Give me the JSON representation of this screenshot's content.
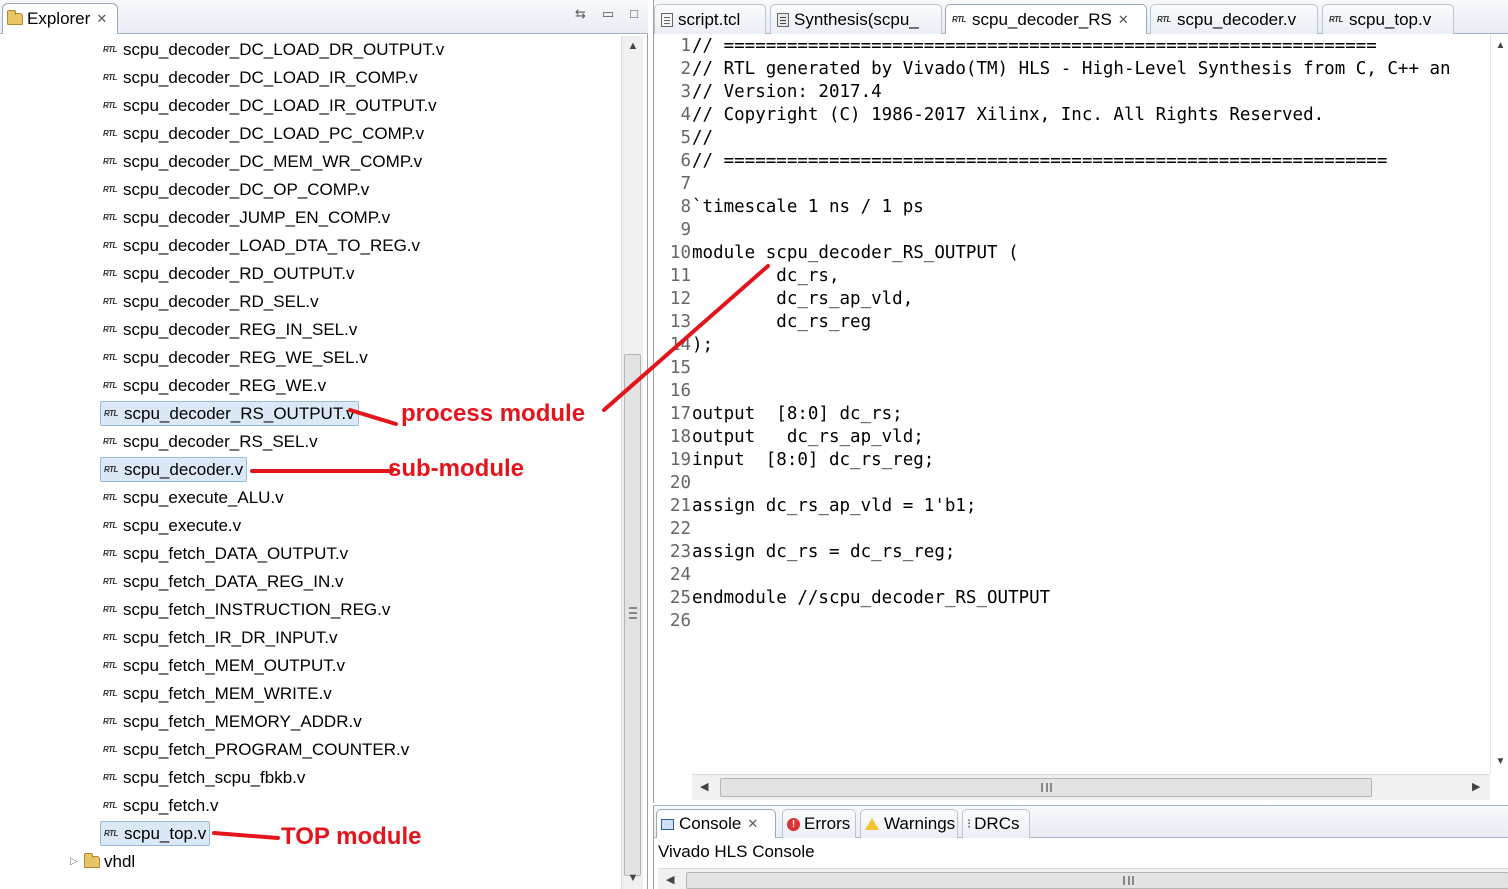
{
  "explorer": {
    "tab_label": "Explorer",
    "tree_items": [
      {
        "label": "scpu_decoder_DC_LOAD_DR_OUTPUT.v",
        "selected": false
      },
      {
        "label": "scpu_decoder_DC_LOAD_IR_COMP.v",
        "selected": false
      },
      {
        "label": "scpu_decoder_DC_LOAD_IR_OUTPUT.v",
        "selected": false
      },
      {
        "label": "scpu_decoder_DC_LOAD_PC_COMP.v",
        "selected": false
      },
      {
        "label": "scpu_decoder_DC_MEM_WR_COMP.v",
        "selected": false
      },
      {
        "label": "scpu_decoder_DC_OP_COMP.v",
        "selected": false
      },
      {
        "label": "scpu_decoder_JUMP_EN_COMP.v",
        "selected": false
      },
      {
        "label": "scpu_decoder_LOAD_DTA_TO_REG.v",
        "selected": false
      },
      {
        "label": "scpu_decoder_RD_OUTPUT.v",
        "selected": false
      },
      {
        "label": "scpu_decoder_RD_SEL.v",
        "selected": false
      },
      {
        "label": "scpu_decoder_REG_IN_SEL.v",
        "selected": false
      },
      {
        "label": "scpu_decoder_REG_WE_SEL.v",
        "selected": false
      },
      {
        "label": "scpu_decoder_REG_WE.v",
        "selected": false
      },
      {
        "label": "scpu_decoder_RS_OUTPUT.v",
        "selected": true
      },
      {
        "label": "scpu_decoder_RS_SEL.v",
        "selected": false
      },
      {
        "label": "scpu_decoder.v",
        "selected": true
      },
      {
        "label": "scpu_execute_ALU.v",
        "selected": false
      },
      {
        "label": "scpu_execute.v",
        "selected": false
      },
      {
        "label": "scpu_fetch_DATA_OUTPUT.v",
        "selected": false
      },
      {
        "label": "scpu_fetch_DATA_REG_IN.v",
        "selected": false
      },
      {
        "label": "scpu_fetch_INSTRUCTION_REG.v",
        "selected": false
      },
      {
        "label": "scpu_fetch_IR_DR_INPUT.v",
        "selected": false
      },
      {
        "label": "scpu_fetch_MEM_OUTPUT.v",
        "selected": false
      },
      {
        "label": "scpu_fetch_MEM_WRITE.v",
        "selected": false
      },
      {
        "label": "scpu_fetch_MEMORY_ADDR.v",
        "selected": false
      },
      {
        "label": "scpu_fetch_PROGRAM_COUNTER.v",
        "selected": false
      },
      {
        "label": "scpu_fetch_scpu_fbkb.v",
        "selected": false
      },
      {
        "label": "scpu_fetch.v",
        "selected": false
      },
      {
        "label": "scpu_top.v",
        "selected": true
      }
    ],
    "folder_label": "vhdl"
  },
  "editor": {
    "tabs": [
      {
        "label": "script.tcl",
        "icon": "tcl-file-icon",
        "active": false
      },
      {
        "label": "Synthesis(scpu_",
        "icon": "synthesis-report-icon",
        "active": false
      },
      {
        "label": "scpu_decoder_RS",
        "icon": "rtl-file-icon",
        "active": true
      },
      {
        "label": "scpu_decoder.v",
        "icon": "rtl-file-icon",
        "active": false
      },
      {
        "label": "scpu_top.v",
        "icon": "rtl-file-icon",
        "active": false
      }
    ],
    "code_lines": [
      {
        "num": "1",
        "text": "// =============================================================="
      },
      {
        "num": "2",
        "text": "// RTL generated by Vivado(TM) HLS - High-Level Synthesis from C, C++ an"
      },
      {
        "num": "3",
        "text": "// Version: 2017.4"
      },
      {
        "num": "4",
        "text": "// Copyright (C) 1986-2017 Xilinx, Inc. All Rights Reserved."
      },
      {
        "num": "5",
        "text": "//"
      },
      {
        "num": "6",
        "text": "// ==============================================================="
      },
      {
        "num": "7",
        "text": ""
      },
      {
        "num": "8",
        "text": "`timescale 1 ns / 1 ps"
      },
      {
        "num": "9",
        "text": ""
      },
      {
        "num": "10",
        "text": "module scpu_decoder_RS_OUTPUT ("
      },
      {
        "num": "11",
        "text": "        dc_rs,"
      },
      {
        "num": "12",
        "text": "        dc_rs_ap_vld,"
      },
      {
        "num": "13",
        "text": "        dc_rs_reg"
      },
      {
        "num": "14",
        "text": ");"
      },
      {
        "num": "15",
        "text": ""
      },
      {
        "num": "16",
        "text": ""
      },
      {
        "num": "17",
        "text": "output  [8:0] dc_rs;"
      },
      {
        "num": "18",
        "text": "output   dc_rs_ap_vld;"
      },
      {
        "num": "19",
        "text": "input  [8:0] dc_rs_reg;"
      },
      {
        "num": "20",
        "text": ""
      },
      {
        "num": "21",
        "text": "assign dc_rs_ap_vld = 1'b1;"
      },
      {
        "num": "22",
        "text": ""
      },
      {
        "num": "23",
        "text": "assign dc_rs = dc_rs_reg;"
      },
      {
        "num": "24",
        "text": ""
      },
      {
        "num": "25",
        "text": "endmodule //scpu_decoder_RS_OUTPUT"
      },
      {
        "num": "26",
        "text": ""
      }
    ]
  },
  "console": {
    "tabs": [
      {
        "label": "Console",
        "active": true
      },
      {
        "label": "Errors",
        "active": false
      },
      {
        "label": "Warnings",
        "active": false
      },
      {
        "label": "DRCs",
        "active": false
      }
    ],
    "title": "Vivado HLS Console"
  },
  "annotations": {
    "process_module": "process module",
    "sub_module": "sub-module",
    "top_module": "TOP module",
    "color": "#e3141b"
  },
  "icons": {
    "file": "rtl-file-icon",
    "folder": "folder-icon",
    "close": "close-icon"
  }
}
